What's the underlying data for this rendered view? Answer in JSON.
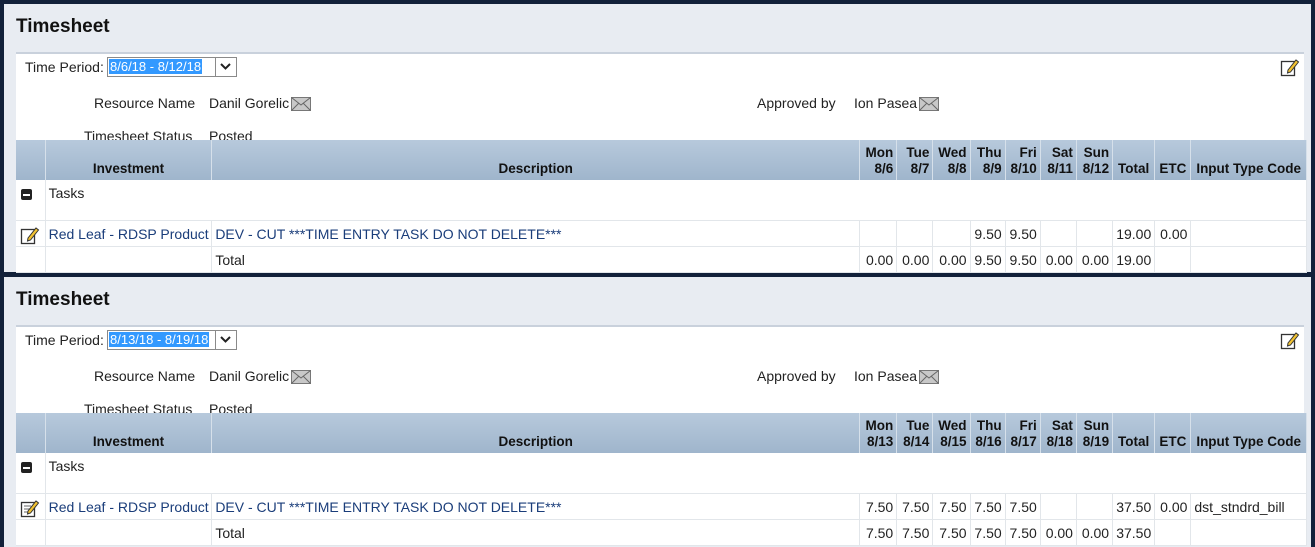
{
  "timesheets": [
    {
      "title": "Timesheet",
      "time_period_label": "Time Period:",
      "time_period_value": "8/6/18 - 8/12/18",
      "resource_name_label": "Resource Name",
      "resource_name": "Danil Gorelic",
      "approved_by_label": "Approved by",
      "approved_by": "Ion Pasea",
      "status_label": "Timesheet Status",
      "status": "Posted",
      "columns": {
        "investment": "Investment",
        "description": "Description",
        "days": [
          {
            "day": "Mon",
            "date": "8/6"
          },
          {
            "day": "Tue",
            "date": "8/7"
          },
          {
            "day": "Wed",
            "date": "8/8"
          },
          {
            "day": "Thu",
            "date": "8/9"
          },
          {
            "day": "Fri",
            "date": "8/10"
          },
          {
            "day": "Sat",
            "date": "8/11"
          },
          {
            "day": "Sun",
            "date": "8/12"
          }
        ],
        "total": "Total",
        "etc": "ETC",
        "input_type_code": "Input Type Code"
      },
      "group_label": "Tasks",
      "task": {
        "investment": "Red Leaf - RDSP Product",
        "description": "DEV - CUT ***TIME ENTRY TASK DO NOT DELETE***",
        "hours": [
          "",
          "",
          "",
          "9.50",
          "9.50",
          "",
          ""
        ],
        "total": "19.00",
        "etc": "0.00",
        "input_type_code": ""
      },
      "totals": {
        "label": "Total",
        "hours": [
          "0.00",
          "0.00",
          "0.00",
          "9.50",
          "9.50",
          "0.00",
          "0.00"
        ],
        "total": "19.00"
      }
    },
    {
      "title": "Timesheet",
      "time_period_label": "Time Period:",
      "time_period_value": "8/13/18 - 8/19/18",
      "resource_name_label": "Resource Name",
      "resource_name": "Danil Gorelic",
      "approved_by_label": "Approved by",
      "approved_by": "Ion Pasea",
      "status_label": "Timesheet Status",
      "status": "Posted",
      "columns": {
        "investment": "Investment",
        "description": "Description",
        "days": [
          {
            "day": "Mon",
            "date": "8/13"
          },
          {
            "day": "Tue",
            "date": "8/14"
          },
          {
            "day": "Wed",
            "date": "8/15"
          },
          {
            "day": "Thu",
            "date": "8/16"
          },
          {
            "day": "Fri",
            "date": "8/17"
          },
          {
            "day": "Sat",
            "date": "8/18"
          },
          {
            "day": "Sun",
            "date": "8/19"
          }
        ],
        "total": "Total",
        "etc": "ETC",
        "input_type_code": "Input Type Code"
      },
      "group_label": "Tasks",
      "task": {
        "investment": "Red Leaf - RDSP Product",
        "description": "DEV - CUT ***TIME ENTRY TASK DO NOT DELETE***",
        "hours": [
          "7.50",
          "7.50",
          "7.50",
          "7.50",
          "7.50",
          "",
          ""
        ],
        "total": "37.50",
        "etc": "0.00",
        "input_type_code": "dst_stndrd_bill"
      },
      "totals": {
        "label": "Total",
        "hours": [
          "7.50",
          "7.50",
          "7.50",
          "7.50",
          "7.50",
          "0.00",
          "0.00"
        ],
        "total": "37.50"
      }
    }
  ],
  "icons": {
    "edit": "edit-pencil-icon",
    "mail": "envelope-icon",
    "collapse": "collapse-minus-icon",
    "dropdown": "chevron-down-icon"
  },
  "colors": {
    "header_gradient_top": "#b7c9dc",
    "header_gradient_bottom": "#9fb5cc",
    "selection": "#3399ff",
    "link": "#1a3d7a",
    "frame": "#12213a"
  }
}
